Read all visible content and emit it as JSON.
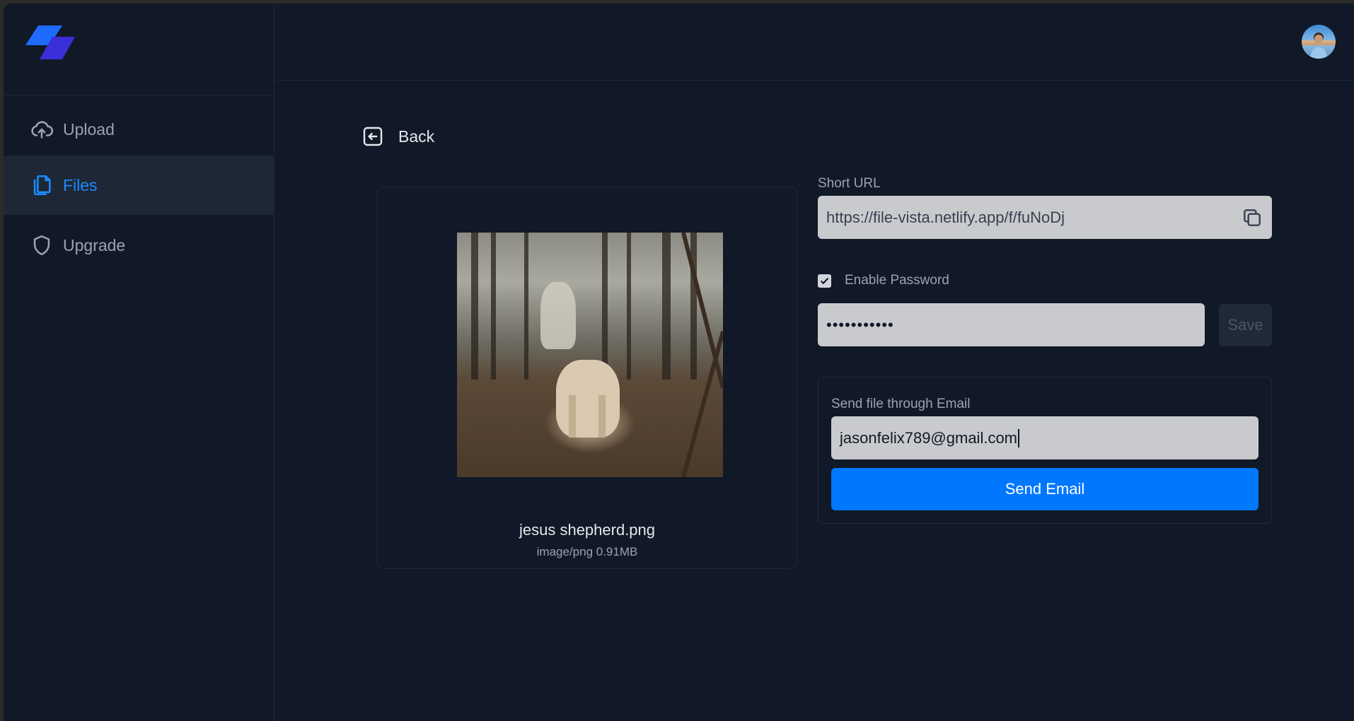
{
  "sidebar": {
    "logo_icon": "brand-logo-icon",
    "items": [
      {
        "label": "Upload",
        "icon": "upload-cloud-icon",
        "active": false
      },
      {
        "label": "Files",
        "icon": "files-icon",
        "active": true
      },
      {
        "label": "Upgrade",
        "icon": "shield-icon",
        "active": false
      }
    ]
  },
  "header": {
    "avatar_icon": "user-avatar"
  },
  "back": {
    "label": "Back",
    "icon": "back-arrow-icon"
  },
  "file": {
    "name": "jesus shepherd.png",
    "meta": "image/png 0.91MB"
  },
  "short_url": {
    "label": "Short URL",
    "value": "https://file-vista.netlify.app/f/fuNoDj",
    "copy_icon": "copy-icon"
  },
  "password": {
    "checkbox_label": "Enable Password",
    "checked": true,
    "value": "•••••••••••",
    "save_label": "Save"
  },
  "email": {
    "label": "Send file through Email",
    "value": "jasonfelix789@gmail.com",
    "button_label": "Send Email"
  },
  "colors": {
    "background": "#111827",
    "accent": "#0077ff",
    "active_nav": "#1a8cff",
    "logo_primary": "#1e6bff",
    "logo_secondary": "#3b2fd9"
  }
}
